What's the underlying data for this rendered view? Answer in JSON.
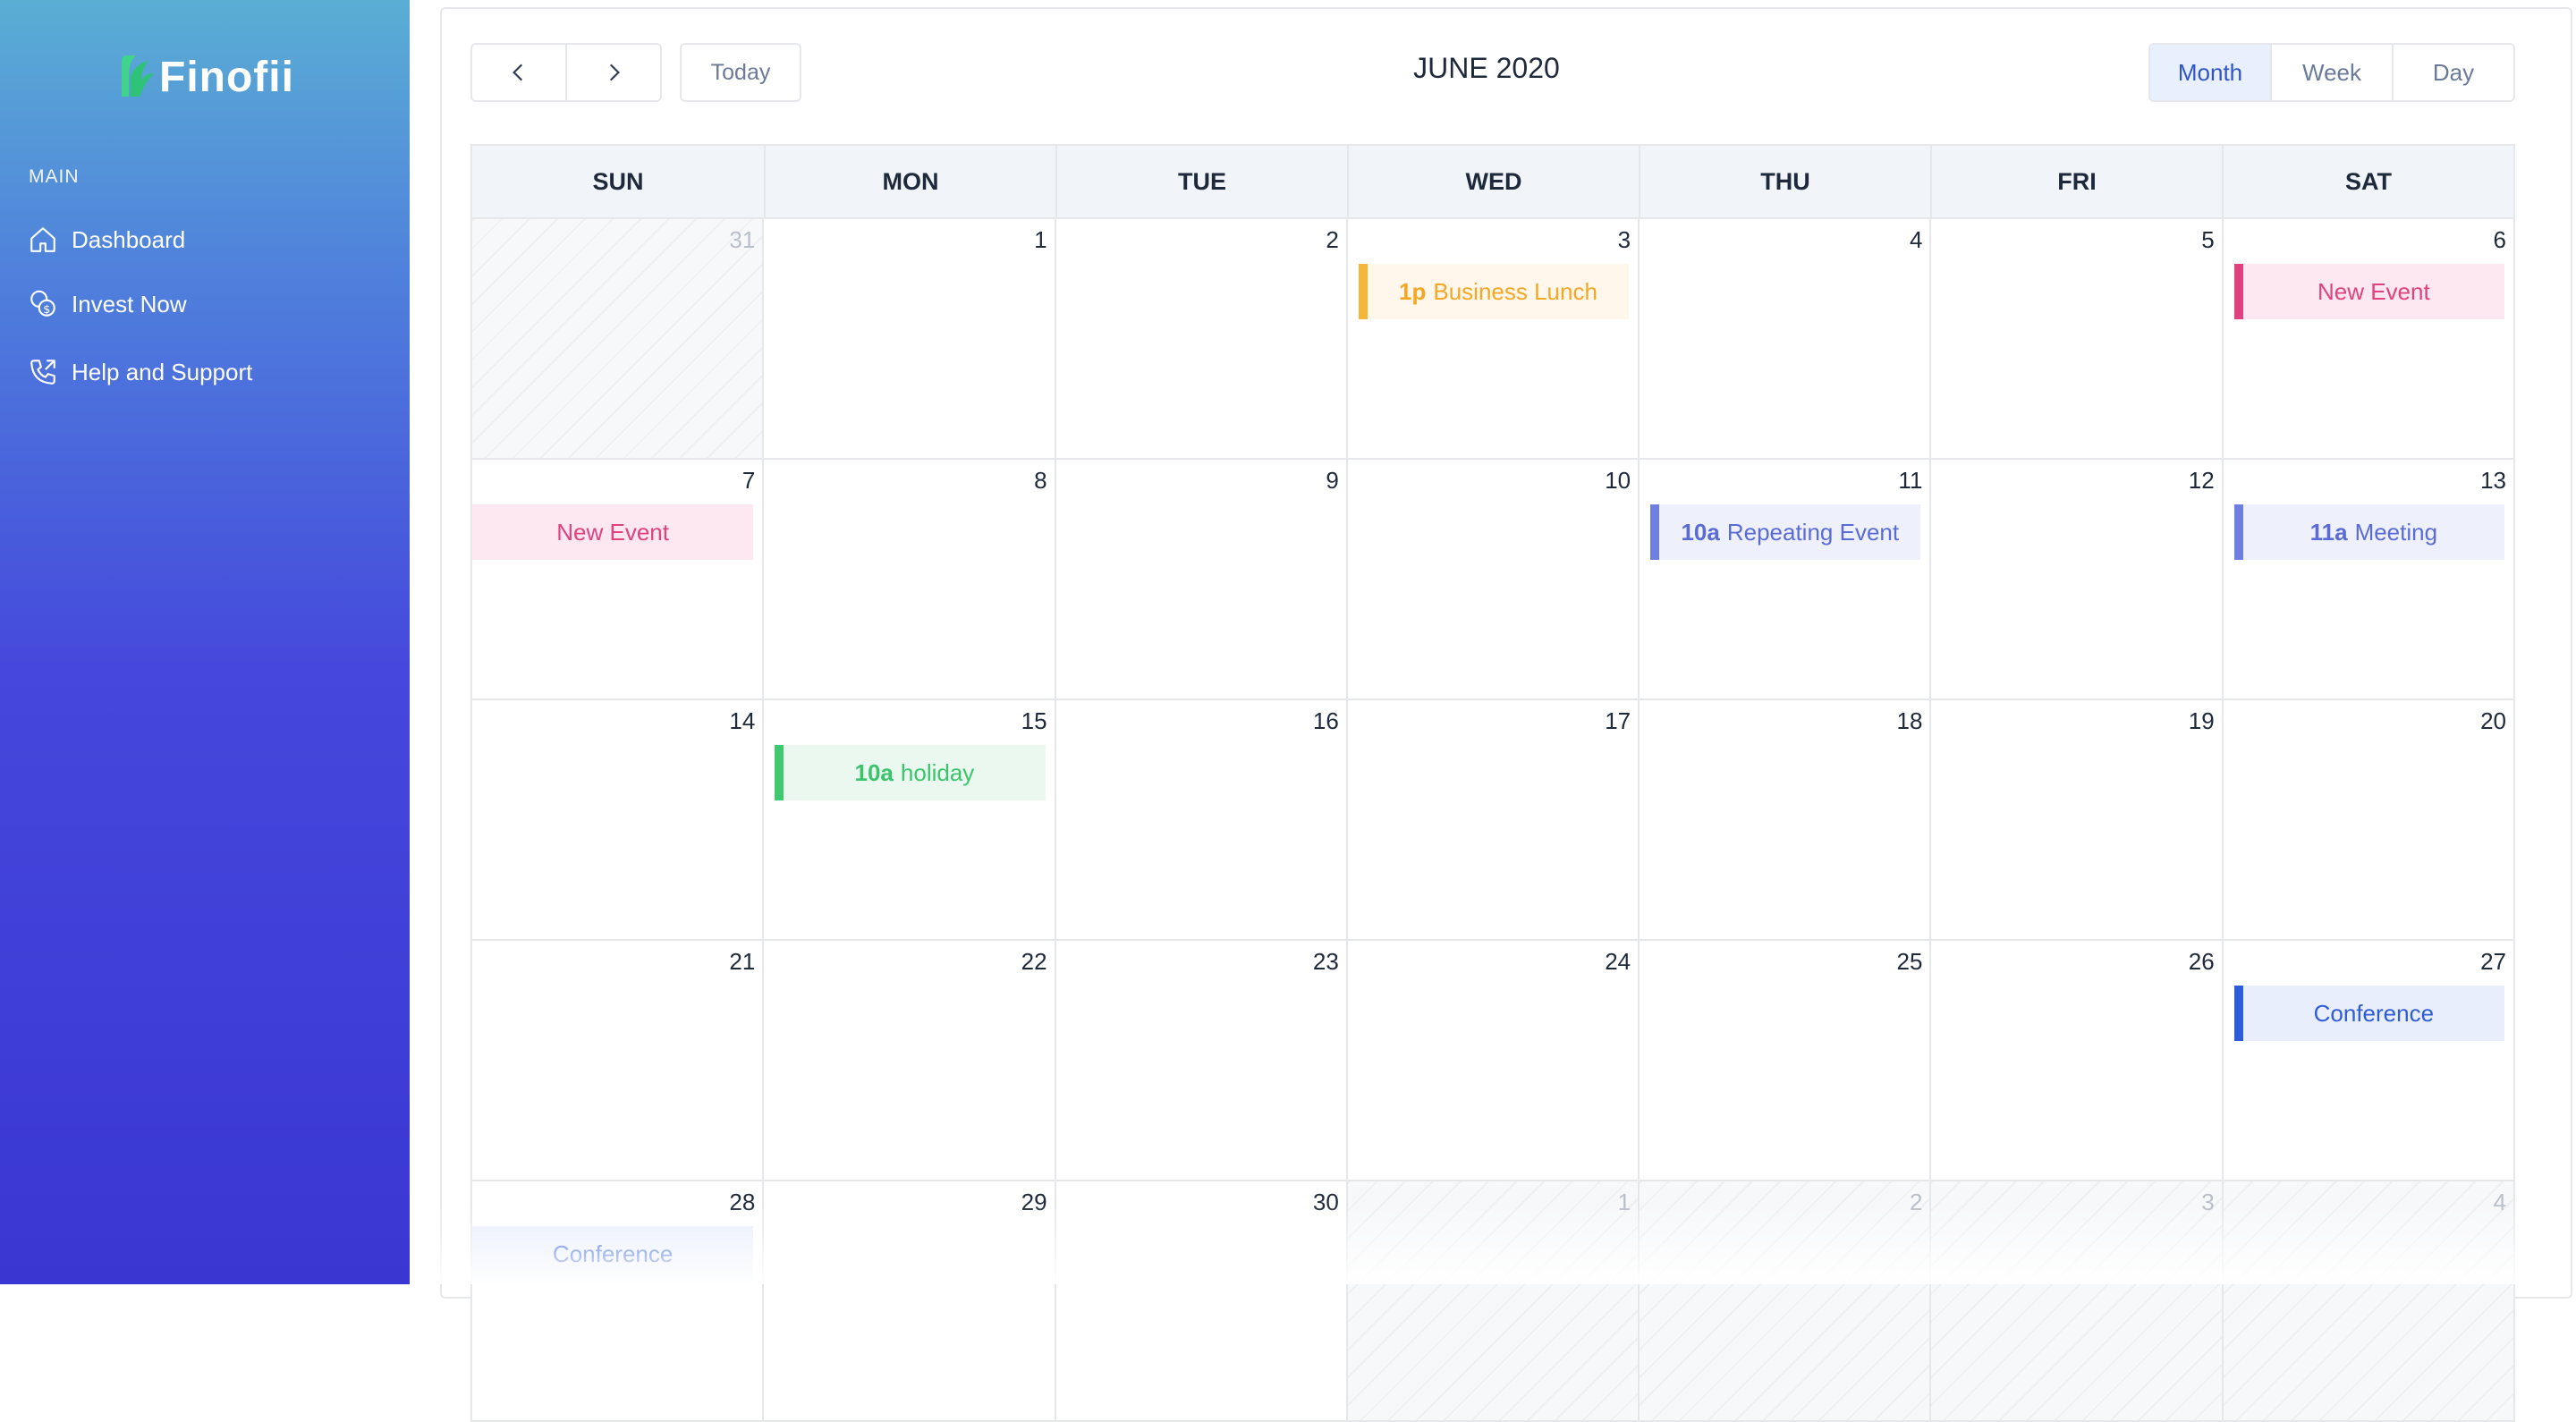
{
  "sidebar": {
    "brand": "Finofii",
    "section_label": "MAIN",
    "items": [
      {
        "label": "Dashboard",
        "icon": "home-icon"
      },
      {
        "label": "Invest Now",
        "icon": "coins-icon"
      },
      {
        "label": "Help and Support",
        "icon": "phone-icon"
      }
    ]
  },
  "toolbar": {
    "prev_icon": "chevron-left-icon",
    "next_icon": "chevron-right-icon",
    "today_label": "Today",
    "title": "JUNE 2020",
    "views": [
      {
        "label": "Month",
        "active": true
      },
      {
        "label": "Week",
        "active": false
      },
      {
        "label": "Day",
        "active": false
      }
    ]
  },
  "calendar": {
    "weekdays": [
      "SUN",
      "MON",
      "TUE",
      "WED",
      "THU",
      "FRI",
      "SAT"
    ],
    "weeks": [
      [
        {
          "day": "31",
          "other_month": true
        },
        {
          "day": "1"
        },
        {
          "day": "2"
        },
        {
          "day": "3",
          "event": {
            "time": "1p",
            "title": "Business Lunch",
            "color": "orange",
            "style": "inset"
          }
        },
        {
          "day": "4"
        },
        {
          "day": "5"
        },
        {
          "day": "6",
          "event": {
            "time": "",
            "title": "New Event",
            "color": "pink",
            "style": "inset"
          }
        }
      ],
      [
        {
          "day": "7",
          "event": {
            "time": "",
            "title": "New Event",
            "color": "pink",
            "style": "flush"
          }
        },
        {
          "day": "8"
        },
        {
          "day": "9"
        },
        {
          "day": "10"
        },
        {
          "day": "11",
          "event": {
            "time": "10a",
            "title": "Repeating Event",
            "color": "blue",
            "style": "inset"
          }
        },
        {
          "day": "12"
        },
        {
          "day": "13",
          "event": {
            "time": "11a",
            "title": "Meeting",
            "color": "blue",
            "style": "inset"
          }
        }
      ],
      [
        {
          "day": "14"
        },
        {
          "day": "15",
          "event": {
            "time": "10a",
            "title": "holiday",
            "color": "green",
            "style": "inset"
          }
        },
        {
          "day": "16"
        },
        {
          "day": "17"
        },
        {
          "day": "18"
        },
        {
          "day": "19"
        },
        {
          "day": "20"
        }
      ],
      [
        {
          "day": "21"
        },
        {
          "day": "22"
        },
        {
          "day": "23"
        },
        {
          "day": "24"
        },
        {
          "day": "25"
        },
        {
          "day": "26"
        },
        {
          "day": "27",
          "event": {
            "time": "",
            "title": "Conference",
            "color": "conf",
            "style": "inset"
          }
        }
      ],
      [
        {
          "day": "28",
          "event": {
            "time": "",
            "title": "Conference",
            "color": "conf",
            "style": "flush"
          }
        },
        {
          "day": "29"
        },
        {
          "day": "30"
        },
        {
          "day": "1",
          "other_month": true
        },
        {
          "day": "2",
          "other_month": true
        },
        {
          "day": "3",
          "other_month": true
        },
        {
          "day": "4",
          "other_month": true
        }
      ]
    ]
  },
  "colors": {
    "sidebar_top": "#5aaed4",
    "sidebar_bottom": "#3a36d2",
    "active_view_bg": "#e8f0fd",
    "event_orange": "#f5a623",
    "event_pink": "#e0427f",
    "event_blue": "#5b6bd6",
    "event_green": "#3cc46c",
    "event_conference": "#2e5bd8"
  }
}
